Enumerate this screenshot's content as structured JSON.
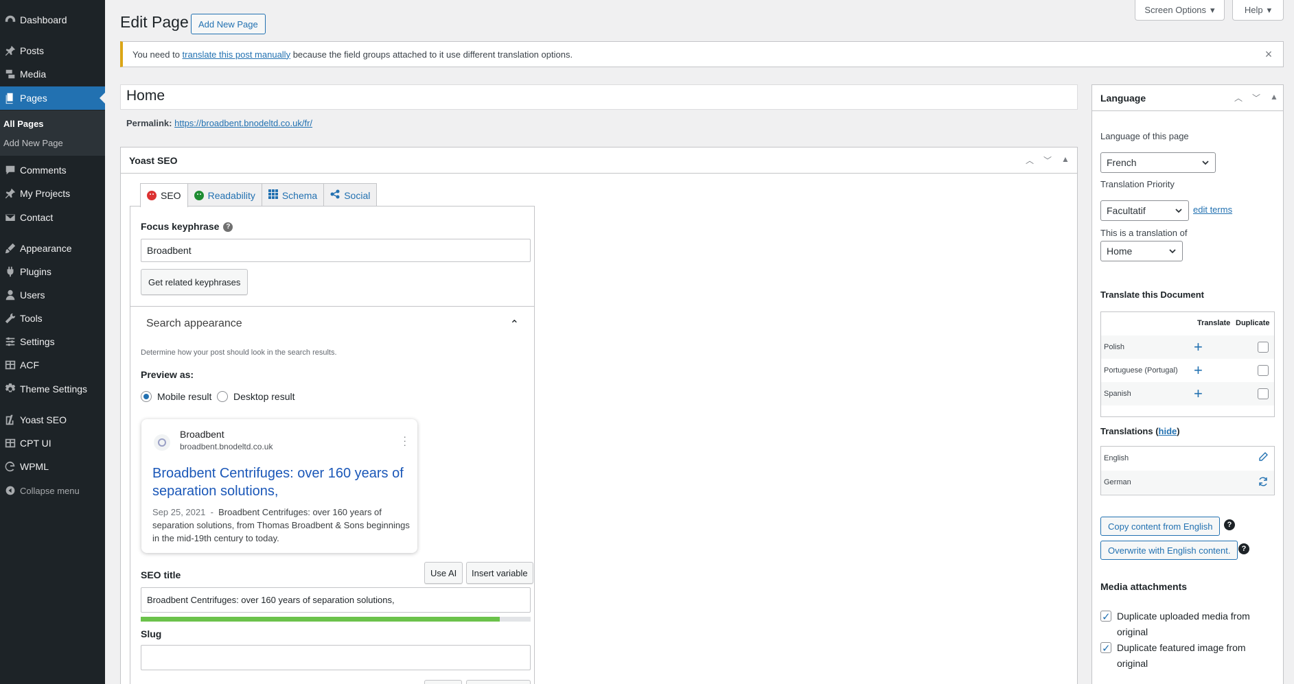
{
  "sidebar": {
    "items": [
      {
        "label": "Dashboard",
        "icon": "dashboard-icon"
      },
      {
        "label": "Posts",
        "icon": "pin-icon"
      },
      {
        "label": "Media",
        "icon": "media-icon"
      },
      {
        "label": "Pages",
        "icon": "pages-icon"
      },
      {
        "label": "Comments",
        "icon": "comment-icon"
      },
      {
        "label": "My Projects",
        "icon": "pin-icon"
      },
      {
        "label": "Contact",
        "icon": "mail-icon"
      },
      {
        "label": "Appearance",
        "icon": "brush-icon"
      },
      {
        "label": "Plugins",
        "icon": "plugin-icon"
      },
      {
        "label": "Users",
        "icon": "user-icon"
      },
      {
        "label": "Tools",
        "icon": "wrench-icon"
      },
      {
        "label": "Settings",
        "icon": "settings-icon"
      },
      {
        "label": "ACF",
        "icon": "grid-icon"
      },
      {
        "label": "Theme Settings",
        "icon": "gear-icon"
      },
      {
        "label": "Yoast SEO",
        "icon": "yoast-icon"
      },
      {
        "label": "CPT UI",
        "icon": "grid-icon"
      },
      {
        "label": "WPML",
        "icon": "wpml-icon"
      }
    ],
    "submenu": [
      "All Pages",
      "Add New Page"
    ],
    "collapse": "Collapse menu"
  },
  "topbar": {
    "screen_options": "Screen Options",
    "help": "Help"
  },
  "header": {
    "title": "Edit Page",
    "add_new": "Add New Page"
  },
  "notice": {
    "prefix": "You need to ",
    "link": "translate this post manually",
    "suffix": " because the field groups attached to it use different translation options."
  },
  "post": {
    "title": "Home",
    "permalink_label": "Permalink:",
    "permalink_url": "https://broadbent.bnodeltd.co.uk/fr/"
  },
  "yoast": {
    "heading": "Yoast SEO",
    "tabs": [
      "SEO",
      "Readability",
      "Schema",
      "Social"
    ],
    "focus_label": "Focus keyphrase",
    "focus_value": "Broadbent",
    "related_btn": "Get related keyphrases",
    "search_appearance": "Search appearance",
    "determine_text": "Determine how your post should look in the search results.",
    "preview_as": "Preview as:",
    "mobile_result": "Mobile result",
    "desktop_result": "Desktop result",
    "serp": {
      "site": "Broadbent",
      "url": "broadbent.bnodeltd.co.uk",
      "title": "Broadbent Centrifuges: over 160 years of separation solutions,",
      "date": "Sep 25, 2021",
      "desc": "Broadbent Centrifuges: over 160 years of separation solutions, from Thomas Broadbent & Sons beginnings in the mid-19th century to today."
    },
    "seo_title_label": "SEO title",
    "use_ai": "Use AI",
    "insert_variable": "Insert variable",
    "seo_title_value": "Broadbent Centrifuges: over 160 years of separation solutions,",
    "seo_title_progress": 0.92,
    "slug_label": "Slug",
    "slug_value": ""
  },
  "language": {
    "heading": "Language",
    "lang_label": "Language of this page",
    "lang_value": "French",
    "priority_label": "Translation Priority",
    "priority_value": "Facultatif",
    "edit_terms": "edit terms",
    "translation_of_label": "This is a translation of",
    "translation_of_value": "Home",
    "translate_doc": "Translate this Document",
    "col_translate": "Translate",
    "col_duplicate": "Duplicate",
    "rows": [
      "Polish",
      "Portuguese (Portugal)",
      "Spanish"
    ],
    "translations_label": "Translations",
    "hide": "hide",
    "existing": [
      {
        "name": "English",
        "icon": "pencil-icon"
      },
      {
        "name": "German",
        "icon": "refresh-icon"
      }
    ],
    "copy_btn": "Copy content from English",
    "overwrite_btn": "Overwrite with English content.",
    "media_label": "Media attachments",
    "dup_media": "Duplicate uploaded media from original",
    "dup_featured": "Duplicate featured image from original"
  },
  "colors": {
    "sidebar": "#1d2327",
    "accent": "#2271b1",
    "warning": "#dba617",
    "good": "#6bc24b"
  }
}
